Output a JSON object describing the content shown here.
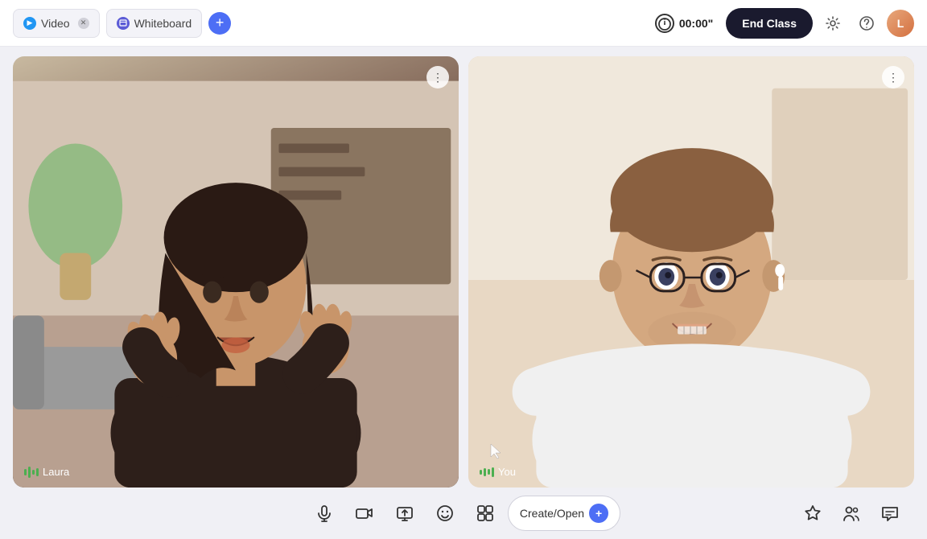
{
  "topbar": {
    "tab_video_label": "Video",
    "tab_whiteboard_label": "Whiteboard",
    "add_tab_label": "+",
    "timer_display": "00:00\"",
    "end_class_label": "End Class",
    "settings_label": "Settings",
    "help_label": "Help",
    "avatar_initials": "L"
  },
  "videos": {
    "laura": {
      "name": "Laura",
      "menu_dots": "⋮"
    },
    "you": {
      "name": "You",
      "menu_dots": "⋮"
    }
  },
  "toolbar": {
    "mic_label": "Microphone",
    "camera_label": "Camera",
    "share_label": "Share Screen",
    "emoji_label": "Emoji",
    "layout_label": "Layout",
    "create_open_label": "Create/Open",
    "add_label": "+",
    "star_label": "Star",
    "participants_label": "Participants",
    "chat_label": "Chat"
  }
}
